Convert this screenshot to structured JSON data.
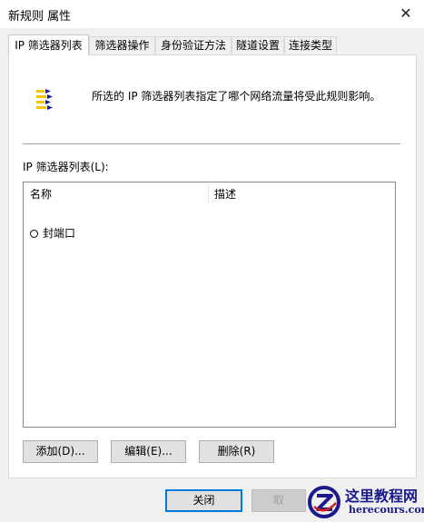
{
  "window": {
    "title": "新规则 属性",
    "close_glyph": "✕"
  },
  "tabs": [
    {
      "label": "IP 筛选器列表",
      "active": true
    },
    {
      "label": "筛选器操作",
      "active": false
    },
    {
      "label": "身份验证方法",
      "active": false
    },
    {
      "label": "隧道设置",
      "active": false
    },
    {
      "label": "连接类型",
      "active": false
    }
  ],
  "panel": {
    "icon": "filter-list-icon",
    "description": "所选的 IP 筛选器列表指定了哪个网络流量将受此规则影响。",
    "list_label": "IP 筛选器列表(L):",
    "columns": [
      "名称",
      "描述"
    ],
    "rows": [
      {
        "name": "封端口",
        "description": "",
        "selected": false
      }
    ],
    "buttons": {
      "add": "添加(D)...",
      "edit": "编辑(E)...",
      "delete": "删除(R)"
    }
  },
  "footer": {
    "close": "关闭",
    "cancel": "取"
  },
  "watermark": {
    "text": "这里教程网",
    "sub": "herecours.com"
  },
  "colors": {
    "accent": "#0078d7",
    "icon_yellow": "#f5c400",
    "watermark_blue": "#1a1a8c"
  }
}
